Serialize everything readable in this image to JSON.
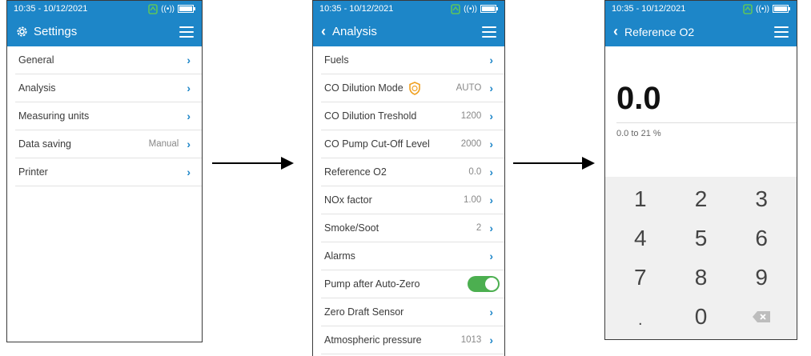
{
  "status": {
    "time": "10:35 - 10/12/2021"
  },
  "colors": {
    "header": "#1d86c8",
    "chevron": "#1d86c8",
    "toggle_on": "#4caf50"
  },
  "screen1": {
    "title": "Settings",
    "items": [
      {
        "label": "General",
        "value": ""
      },
      {
        "label": "Analysis",
        "value": ""
      },
      {
        "label": "Measuring units",
        "value": ""
      },
      {
        "label": "Data saving",
        "value": "Manual"
      },
      {
        "label": "Printer",
        "value": ""
      }
    ]
  },
  "screen2": {
    "title": "Analysis",
    "items": [
      {
        "label": "Fuels",
        "value": ""
      },
      {
        "label": "CO Dilution Mode",
        "value": "AUTO"
      },
      {
        "label": "CO Dilution Treshold",
        "value": "1200"
      },
      {
        "label": "CO Pump Cut-Off Level",
        "value": "2000"
      },
      {
        "label": "Reference O2",
        "value": "0.0"
      },
      {
        "label": "NOx factor",
        "value": "1.00"
      },
      {
        "label": "Smoke/Soot",
        "value": "2"
      },
      {
        "label": "Alarms",
        "value": ""
      },
      {
        "label": "Pump after Auto-Zero",
        "value": ""
      },
      {
        "label": "Zero Draft Sensor",
        "value": ""
      },
      {
        "label": "Atmospheric pressure",
        "value": "1013"
      }
    ],
    "pump_after_autozero_on": true
  },
  "screen3": {
    "title": "Reference O2",
    "value": "0.0",
    "range": "0.0 to 21 %",
    "keys": [
      "1",
      "2",
      "3",
      "4",
      "5",
      "6",
      "7",
      "8",
      "9",
      ".",
      "0",
      "⌫"
    ]
  }
}
